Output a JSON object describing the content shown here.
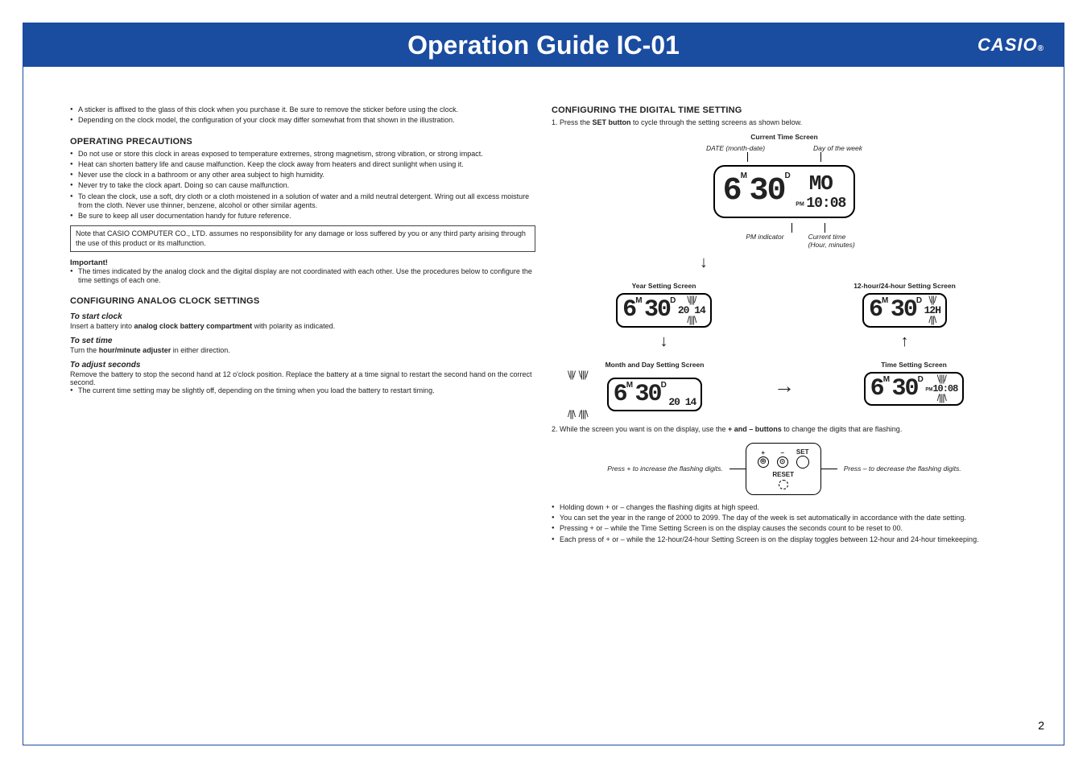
{
  "header": {
    "title": "Operation Guide IC-01",
    "brand": "CASIO",
    "brand_mark": "®"
  },
  "page_number": "2",
  "left": {
    "top_notes": [
      "A sticker is affixed to the glass of this clock when you purchase it. Be sure to remove the sticker before using the clock.",
      "Depending on the clock model, the configuration of your clock may differ somewhat from that shown in the illustration."
    ],
    "precautions_h": "OPERATING PRECAUTIONS",
    "precautions": [
      "Do not use or store this clock in areas exposed to temperature extremes, strong magnetism, strong vibration, or strong impact.",
      "Heat can shorten battery life and cause malfunction. Keep the clock away from heaters and direct sunlight when using it.",
      "Never use the clock in a bathroom or any other area subject to high humidity.",
      "Never try to take the clock apart. Doing so can cause malfunction.",
      "To clean the clock, use a soft, dry cloth or a cloth moistened in a solution of water and a mild neutral detergent. Wring out all excess moisture from the cloth. Never use thinner, benzene, alcohol or other similar agents.",
      "Be sure to keep all user documentation handy for future reference."
    ],
    "disclaimer": "Note that CASIO COMPUTER CO., LTD. assumes no responsibility for any damage or loss suffered by you or any third party arising through the use of this product or its malfunction.",
    "important_h": "Important!",
    "important_note": "The times indicated by the analog clock and the digital display are not coordinated with each other. Use the procedures below to configure the time settings of each one.",
    "analog_h": "CONFIGURING ANALOG CLOCK SETTINGS",
    "start_h": "To start clock",
    "start_t1": "Insert a battery into ",
    "start_t1b": "analog clock battery compartment",
    "start_t1c": " with polarity as indicated.",
    "time_h": "To set time",
    "time_t1": "Turn the ",
    "time_t1b": "hour/minute adjuster",
    "time_t1c": " in either direction.",
    "sec_h": "To adjust seconds",
    "sec_text": "Remove the battery to stop the second hand at 12 o'clock position. Replace the battery at a time signal to restart the second hand on the correct second.",
    "sec_note": "The current time setting may be slightly off, depending on the timing when you load the battery to restart timing."
  },
  "right": {
    "digital_h": "CONFIGURING THE DIGITAL TIME SETTING",
    "step1a": "1. Press the ",
    "step1b": "SET button",
    "step1c": " to cycle through the setting screens as shown below.",
    "labels": {
      "current": "Current Time Screen",
      "date": "DATE (month-date)",
      "dow": "Day of the week",
      "pm": "PM indicator",
      "cur_time": "Current time\n(Hour, minutes)",
      "year": "Year Setting Screen",
      "h1224": "12-hour/24-hour Setting Screen",
      "month_day": "Month and Day Setting Screen",
      "time_set": "Time Setting Screen"
    },
    "display_main": {
      "month": "6",
      "date": "30",
      "m_mark": "M",
      "d_mark": "D",
      "dow": "MO",
      "pm_mark": "PM",
      "time": "10:08"
    },
    "display_year": {
      "month": "6",
      "date": "30",
      "year": "20 14"
    },
    "display_1224": {
      "month": "6",
      "date": "30",
      "mode": "12H"
    },
    "display_monthday": {
      "month": "6",
      "date": "30",
      "extra": "20 14"
    },
    "display_timeset": {
      "month": "6",
      "date": "30",
      "pm": "PM",
      "time": "10:08"
    },
    "step2a": "2. While the screen you want is on the display, use the ",
    "step2b": "+ and – buttons",
    "step2c": " to change the digits that are flashing.",
    "btns": {
      "plus": "+",
      "minus": "–",
      "set": "SET",
      "reset": "RESET",
      "left": "Press + to increase the flashing digits.",
      "right": "Press – to decrease the flashing digits."
    },
    "notes": [
      "Holding down + or – changes the flashing digits at high speed.",
      "You can set the year in the range of 2000 to 2099. The day of the week is set automatically in accordance with the date setting.",
      "Pressing + or – while the Time Setting Screen is on the display causes the seconds count to be reset to 00.",
      "Each press of + or – while the 12-hour/24-hour Setting Screen is on the display toggles between 12-hour and 24-hour timekeeping."
    ]
  }
}
